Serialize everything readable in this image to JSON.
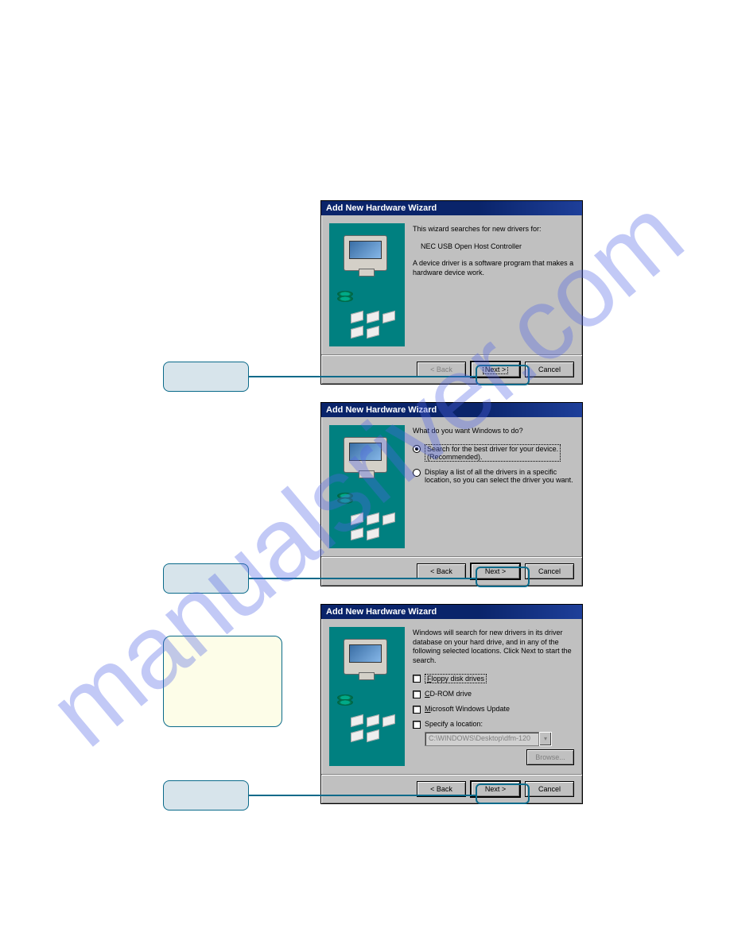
{
  "watermark": "manualsriver.com",
  "dialog1": {
    "title": "Add New Hardware Wizard",
    "line1": "This wizard searches for new drivers for:",
    "device": "NEC USB Open Host Controller",
    "line2": "A device driver is a software program that makes a hardware device work.",
    "back": "< Back",
    "next": "Next >",
    "cancel": "Cancel"
  },
  "dialog2": {
    "title": "Add New Hardware Wizard",
    "prompt": "What do you want Windows to do?",
    "opt1a": "Search for the best driver for your device.",
    "opt1b": "(Recommended).",
    "opt2": "Display a list of all the drivers in a specific location, so you can select the driver you want.",
    "back": "< Back",
    "next": "Next >",
    "cancel": "Cancel"
  },
  "dialog3": {
    "title": "Add New Hardware Wizard",
    "intro": "Windows will search for new drivers in its driver database on your hard drive, and in any of the following selected locations. Click Next to start the search.",
    "chk1": "Floppy disk drives",
    "chk2": "CD-ROM drive",
    "chk3": "Microsoft Windows Update",
    "chk4": "Specify a location:",
    "path": "C:\\WINDOWS\\Desktop\\dfm-120",
    "browse": "Browse...",
    "back": "< Back",
    "next": "Next >",
    "cancel": "Cancel"
  }
}
